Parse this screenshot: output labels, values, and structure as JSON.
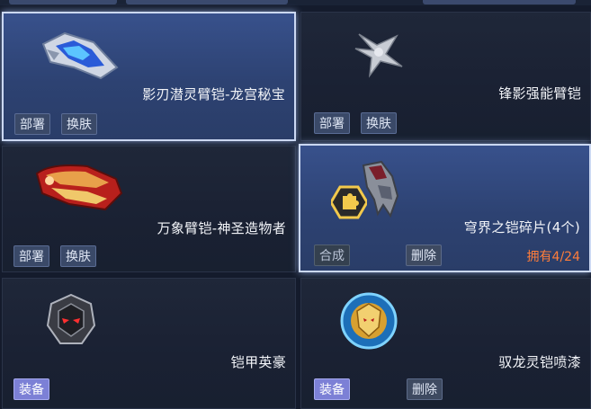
{
  "items": [
    {
      "name": "影刃潜灵臂铠-龙宫秘宝",
      "buttons": [
        "部署",
        "换肤"
      ],
      "selected": true
    },
    {
      "name": "锋影强能臂铠",
      "buttons": [
        "部署",
        "换肤"
      ],
      "selected": false
    },
    {
      "name": "万象臂铠-神圣造物者",
      "buttons": [
        "部署",
        "换肤"
      ],
      "selected": false
    },
    {
      "name": "穹界之铠碎片(4个)",
      "buttons": [
        "合成",
        "删除"
      ],
      "owned": "拥有4/24",
      "selected": true
    },
    {
      "name": "铠甲英豪",
      "buttons": [
        "装备"
      ],
      "selected": false
    },
    {
      "name": "驭龙灵铠喷漆",
      "buttons": [
        "装备",
        "删除"
      ],
      "selected": false
    }
  ],
  "colors": {
    "selected_bg": "#2d4272",
    "owned_text": "#ff7d3a",
    "equip_button": "#7c80d6"
  }
}
